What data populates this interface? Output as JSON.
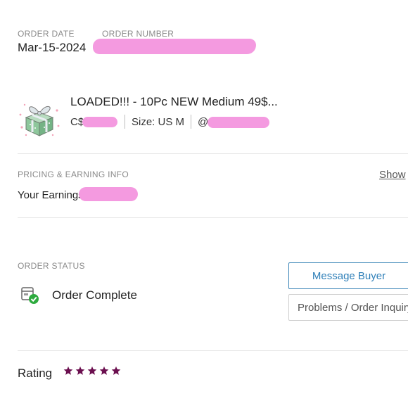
{
  "order": {
    "date_label": "ORDER DATE",
    "date_value": "Mar-15-2024",
    "number_label": "ORDER NUMBER"
  },
  "product": {
    "title": "LOADED!!! - 10Pc NEW Medium 49$...",
    "price_prefix": "C$",
    "size": "Size: US M",
    "user_prefix": "@"
  },
  "pricing": {
    "section_label": "PRICING & EARNING INFO",
    "show_link": "Show",
    "earnings_label": "Your Earnings:"
  },
  "status": {
    "section_label": "ORDER STATUS",
    "value": "Order Complete",
    "message_button": "Message Buyer",
    "problems_button": "Problems / Order Inquiry"
  },
  "rating": {
    "label": "Rating",
    "stars": 5,
    "star_color": "#6b0f4f"
  },
  "colors": {
    "accent": "#2e7fb8",
    "check_green": "#2eab3f",
    "redaction": "#f49ae0"
  }
}
